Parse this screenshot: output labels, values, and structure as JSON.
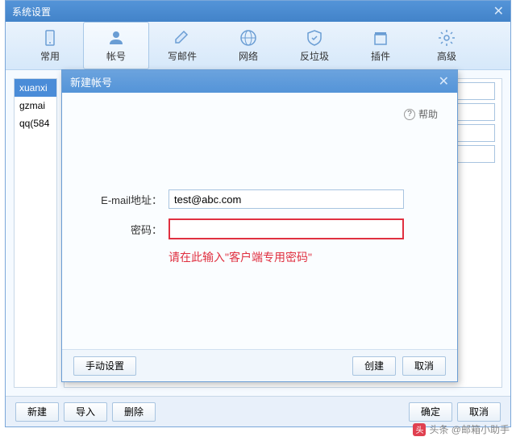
{
  "window": {
    "title": "系统设置"
  },
  "tabs": [
    {
      "label": "常用"
    },
    {
      "label": "帐号"
    },
    {
      "label": "写邮件"
    },
    {
      "label": "网络"
    },
    {
      "label": "反垃圾"
    },
    {
      "label": "插件"
    },
    {
      "label": "高级"
    }
  ],
  "accounts": [
    {
      "name": "xuanxi"
    },
    {
      "name": "gzmai"
    },
    {
      "name": "qq(584"
    }
  ],
  "bottomButtons": {
    "new": "新建",
    "import": "导入",
    "delete": "删除",
    "ok": "确定",
    "cancel": "取消"
  },
  "modal": {
    "title": "新建帐号",
    "help": "帮助",
    "emailLabel": "E-mail地址：",
    "emailValue": "test@abc.com",
    "passwordLabel": "密码：",
    "passwordValue": "",
    "hint": "请在此输入\"客户端专用密码\"",
    "manual": "手动设置",
    "create": "创建",
    "cancel": "取消"
  },
  "watermark": "头条 @邮箱小助手"
}
